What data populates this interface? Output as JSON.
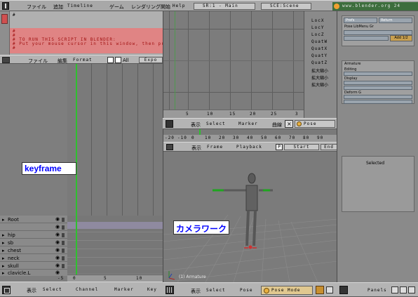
{
  "topbar": {
    "menus": [
      "ファイル",
      "追加",
      "Timeline",
      "ゲーム",
      "レンダリング開始",
      "Help"
    ],
    "scene_selector": "SR:1 - Main",
    "scene_name": "SCE:Scene",
    "website": "www.blender.org 24"
  },
  "script_panel": {
    "lines": [
      "#",
      "#",
      "#",
      "#   TO RUN THIS SCRIPT IN BLENDER:",
      "#   Put your mouse cursor in this window, then pre",
      "#"
    ]
  },
  "text_header": {
    "file_menu": "ファイル",
    "edit_menu": "編集",
    "format_menu": "Format",
    "all_label": "All",
    "export_label": "Expo"
  },
  "action_editor": {
    "channels": [
      "Root",
      "hip",
      "sb",
      "chest",
      "neck",
      "skull",
      "clavicle.L"
    ],
    "ruler_ticks": [
      "-5",
      "0",
      "5",
      "10"
    ],
    "header_menus": [
      "表示",
      "Select",
      "Channel",
      "Marker",
      "Key"
    ]
  },
  "ipo_editor": {
    "ruler_ticks": [
      "5",
      "10",
      "15",
      "20",
      "25",
      "3"
    ],
    "channels": [
      "LocX",
      "LocY",
      "LocZ",
      "QuatW",
      "QuatX",
      "QuatY",
      "QuatZ",
      "拡大縮小",
      "拡大縮小",
      "拡大縮小"
    ],
    "header_menus": [
      "表示",
      "Select",
      "Marker",
      "曲線"
    ],
    "mode_label": "Pose"
  },
  "timeline": {
    "ruler_ticks": [
      "-20",
      "-10",
      "0",
      "10",
      "20",
      "30",
      "40",
      "50",
      "60",
      "70",
      "80",
      "90"
    ],
    "header_menus": [
      "表示",
      "Frame",
      "Playback"
    ],
    "start_label": "Start",
    "end_label": "End"
  },
  "viewport": {
    "object_label": "(1) Armature",
    "header_menus": [
      "表示",
      "Select",
      "Pose"
    ],
    "mode_label": "Pose Mode"
  },
  "buttons_panel": {
    "top_buttons": [
      "Prefs",
      "Return",
      "Pose LibMenu Gr"
    ],
    "count_field": "Add 1/2",
    "sections": [
      "Armature",
      "Editing",
      "Display",
      "Deform G"
    ],
    "selected_label": "Selected",
    "header_label": "Panels"
  },
  "annotations": {
    "keyframe": "keyframe",
    "camera": "カメラワーク"
  },
  "colors": {
    "panel_gray": "#7a7a7a",
    "header_gray": "#b4b4b4",
    "script_red": "#e08484",
    "cursor_green": "#30c030",
    "annotation_blue": "#0000ff"
  }
}
